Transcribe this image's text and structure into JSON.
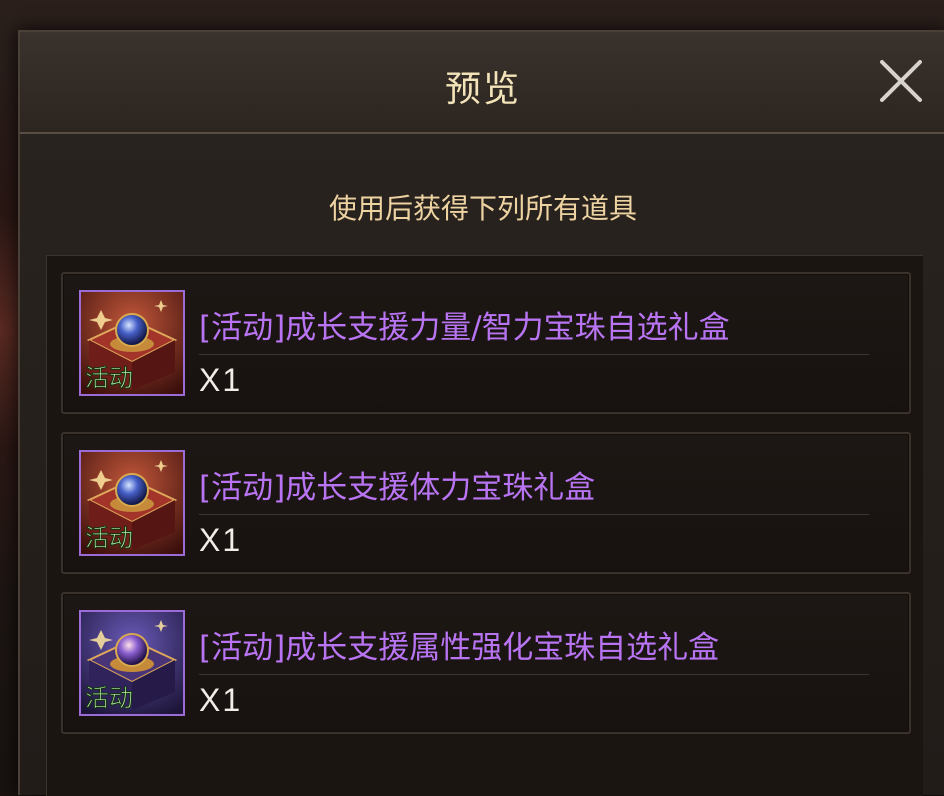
{
  "dialog": {
    "title": "预览",
    "close_icon": "close-icon",
    "subtitle": "使用后获得下列所有道具"
  },
  "items": [
    {
      "name": "[活动]成长支援力量/智力宝珠自选礼盒",
      "quantity": "X1",
      "icon_tag": "活动",
      "icon": "red-gift-box-orb-icon",
      "box_color": "#8b2a24"
    },
    {
      "name": "[活动]成长支援体力宝珠礼盒",
      "quantity": "X1",
      "icon_tag": "活动",
      "icon": "red-gift-box-orb-icon",
      "box_color": "#8b2a24"
    },
    {
      "name": "[活动]成长支援属性强化宝珠自选礼盒",
      "quantity": "X1",
      "icon_tag": "活动",
      "icon": "purple-gift-box-orb-icon",
      "box_color": "#4a3478"
    }
  ],
  "colors": {
    "item_name": "#b874f2",
    "title": "#f3e3b8",
    "subtitle": "#eed3a2",
    "icon_border": "#9b6bd6",
    "tag_text": "#bff0a8"
  }
}
